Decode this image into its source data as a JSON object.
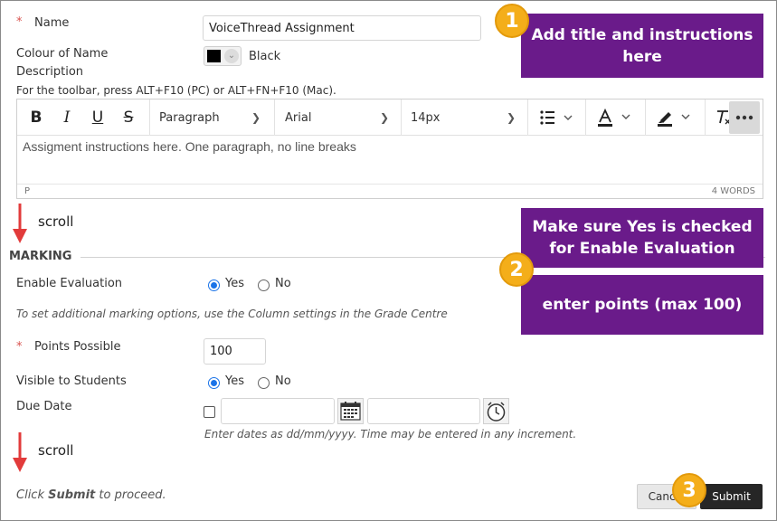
{
  "form": {
    "name_label": "Name",
    "required_mark": "*",
    "name_value": "VoiceThread Assignment",
    "colour_label": "Colour of Name",
    "colour_value": "Black",
    "description_label": "Description",
    "toolbar_hint": "For the toolbar, press ALT+F10 (PC) or ALT+FN+F10 (Mac)."
  },
  "editor": {
    "bold": "B",
    "italic": "I",
    "underline": "U",
    "strike": "S",
    "paragraph": "Paragraph",
    "font": "Arial",
    "size": "14px",
    "body_text": "Assigment instructions here. One paragraph, no line breaks",
    "path": "P",
    "word_count": "4 WORDS"
  },
  "scroll_label": "scroll",
  "marking": {
    "heading": "MARKING",
    "enable_label": "Enable Evaluation",
    "yes": "Yes",
    "no": "No",
    "hint": "To set additional marking options, use the Column settings in the Grade Centre",
    "points_label": "Points Possible",
    "points_value": "100",
    "visible_label": "Visible to Students",
    "due_label": "Due Date",
    "date_hint": "Enter dates as dd/mm/yyyy. Time may be entered in any increment."
  },
  "footer": {
    "click_prefix": "Click ",
    "click_bold": "Submit",
    "click_suffix": " to proceed.",
    "cancel": "Cancel",
    "submit": "Submit"
  },
  "callouts": {
    "c1_number": "1",
    "c1_text": "Add title and instructions here",
    "c2_number": "2",
    "c2_text_a": "Make sure Yes is checked for Enable Evaluation",
    "c2_text_b": "enter points (max 100)",
    "c3_number": "3"
  },
  "colors": {
    "callout_purple": "#6a1b8a",
    "badge_orange": "#f4ae1a",
    "arrow_red": "#e23b3b",
    "radio_blue": "#1a73e8"
  }
}
